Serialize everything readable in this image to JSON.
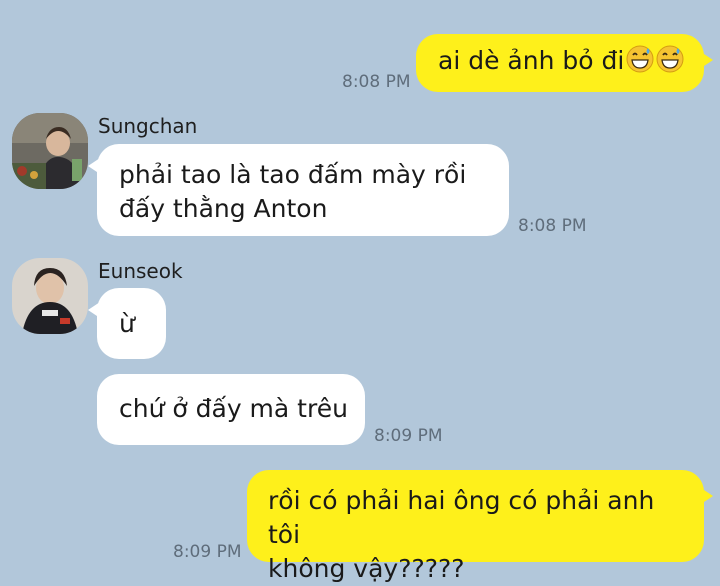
{
  "messages": [
    {
      "id": "m1",
      "direction": "out",
      "text_before_emoji": "ai dè ảnh bỏ đi",
      "emoji": [
        "grinning-sweat-emoji",
        "grinning-sweat-emoji"
      ],
      "time": "8:08 PM"
    },
    {
      "id": "m2",
      "direction": "in",
      "sender": "Sungchan",
      "lines": [
        "phải tao là tao đấm mày rồi",
        "đấy thằng Anton"
      ],
      "time": "8:08 PM"
    },
    {
      "id": "m3",
      "direction": "in",
      "sender": "Eunseok",
      "text": "ừ"
    },
    {
      "id": "m4",
      "direction": "in",
      "text": "chứ ở đấy mà trêu",
      "time": "8:09 PM"
    },
    {
      "id": "m5",
      "direction": "out",
      "lines": [
        "rồi có phải hai ông có phải anh tôi",
        "không vậy?????"
      ],
      "time": "8:09 PM"
    }
  ],
  "colors": {
    "background": "#b2c7da",
    "incoming_bubble": "#ffffff",
    "outgoing_bubble": "#fef01b",
    "timestamp": "#5f6d7b"
  }
}
